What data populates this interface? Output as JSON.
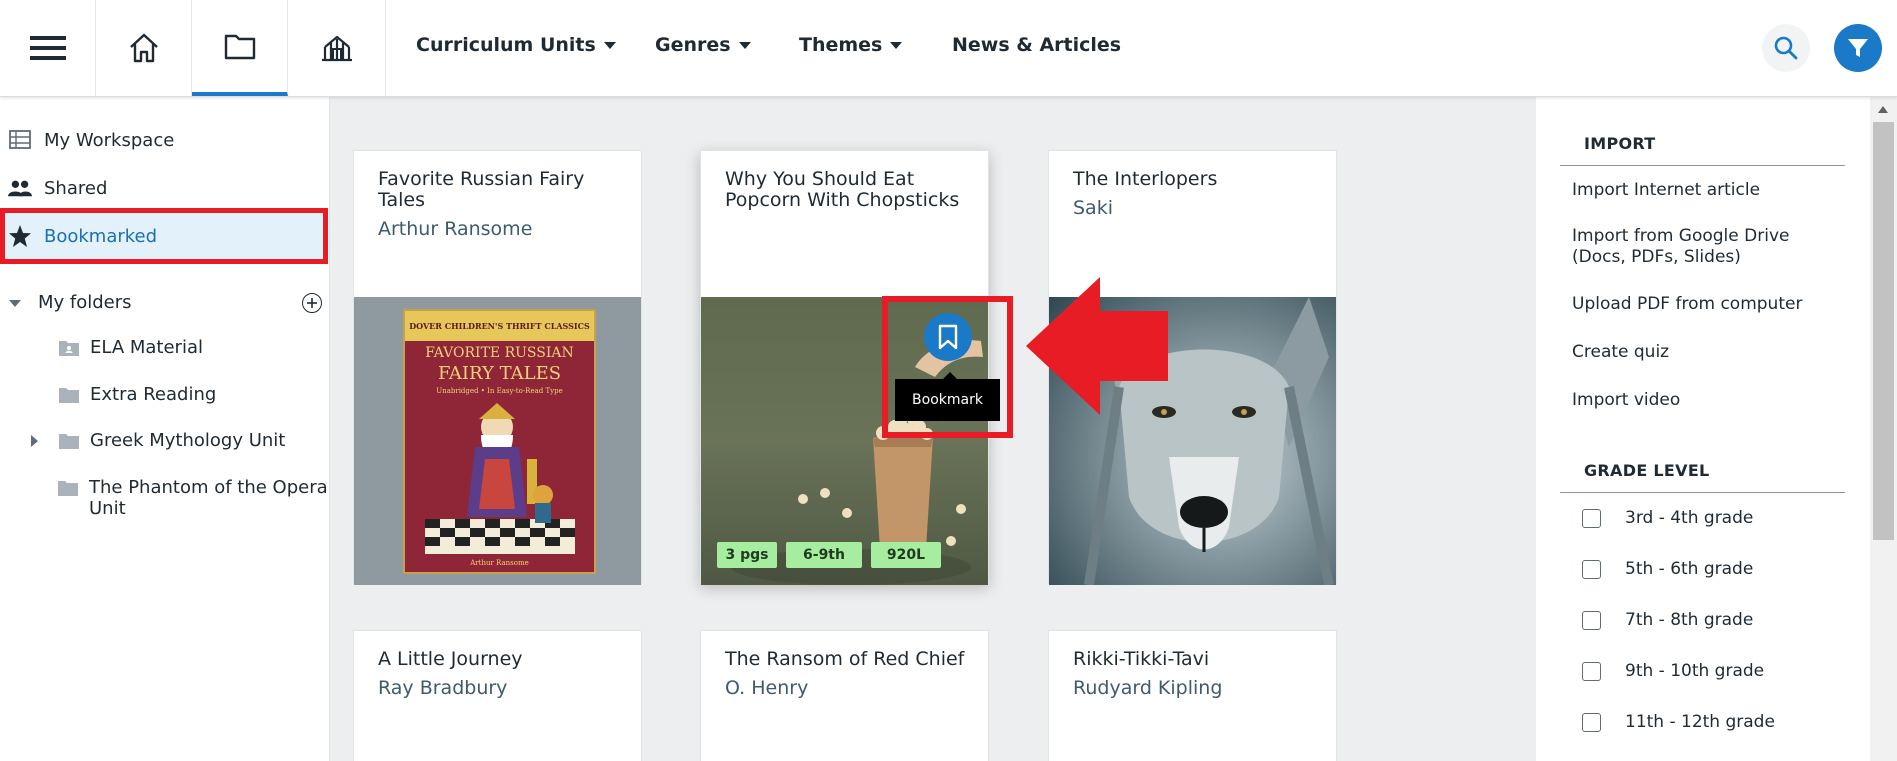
{
  "topbar": {
    "nav": [
      {
        "label": "Curriculum Units",
        "dropdown": true
      },
      {
        "label": "Genres",
        "dropdown": true
      },
      {
        "label": "Themes",
        "dropdown": true
      },
      {
        "label": "News & Articles",
        "dropdown": false
      }
    ],
    "icons": [
      "menu-icon",
      "home-icon",
      "folder-icon",
      "library-icon",
      "search-icon",
      "filter-icon"
    ],
    "accent": "#1a7ac8"
  },
  "sidebar": {
    "items": [
      {
        "label": "My Workspace",
        "icon": "workspace-icon"
      },
      {
        "label": "Shared",
        "icon": "people-icon"
      },
      {
        "label": "Bookmarked",
        "icon": "star-icon",
        "selected": true
      }
    ],
    "folders_label": "My folders",
    "folders": [
      {
        "label": "ELA Material",
        "expandable": false
      },
      {
        "label": "Extra Reading",
        "expandable": false
      },
      {
        "label": "Greek Mythology Unit",
        "expandable": true
      },
      {
        "label": "The Phantom of the Opera Unit",
        "expandable": false
      }
    ]
  },
  "cards": [
    {
      "title": "Favorite Russian Fairy Tales",
      "author": "Arthur Ransome",
      "cover": {
        "series": "DOVER CHILDREN'S THRIFT CLASSICS",
        "title_line1": "FAVORITE RUSSIAN",
        "title_line2": "FAIRY TALES",
        "subtitle": "Unabridged • In Easy-to-Read Type",
        "author": "Arthur Ransome"
      }
    },
    {
      "title": "Why You Should Eat Popcorn With Chopsticks",
      "author": "",
      "badges": [
        "3 pgs",
        "6-9th",
        "920L"
      ],
      "tooltip": "Bookmark"
    },
    {
      "title": "The Interlopers",
      "author": "Saki"
    },
    {
      "title": "A Little Journey",
      "author": "Ray Bradbury"
    },
    {
      "title": "The Ransom of Red Chief",
      "author": "O. Henry"
    },
    {
      "title": "Rikki-Tikki-Tavi",
      "author": "Rudyard Kipling"
    }
  ],
  "right_panel": {
    "import_heading": "IMPORT",
    "import_links": [
      "Import Internet article",
      "Import from Google Drive (Docs, PDFs, Slides)",
      "Upload PDF from computer",
      "Create quiz",
      "Import video"
    ],
    "grade_heading": "GRADE LEVEL",
    "grades": [
      "3rd - 4th grade",
      "5th - 6th grade",
      "7th - 8th grade",
      "9th - 10th grade",
      "11th - 12th grade"
    ]
  },
  "colors": {
    "highlight": "#e81c24",
    "badge": "#a6eda0",
    "link_author": "#3e5b6e",
    "selected_bg": "#e3f1fb"
  }
}
